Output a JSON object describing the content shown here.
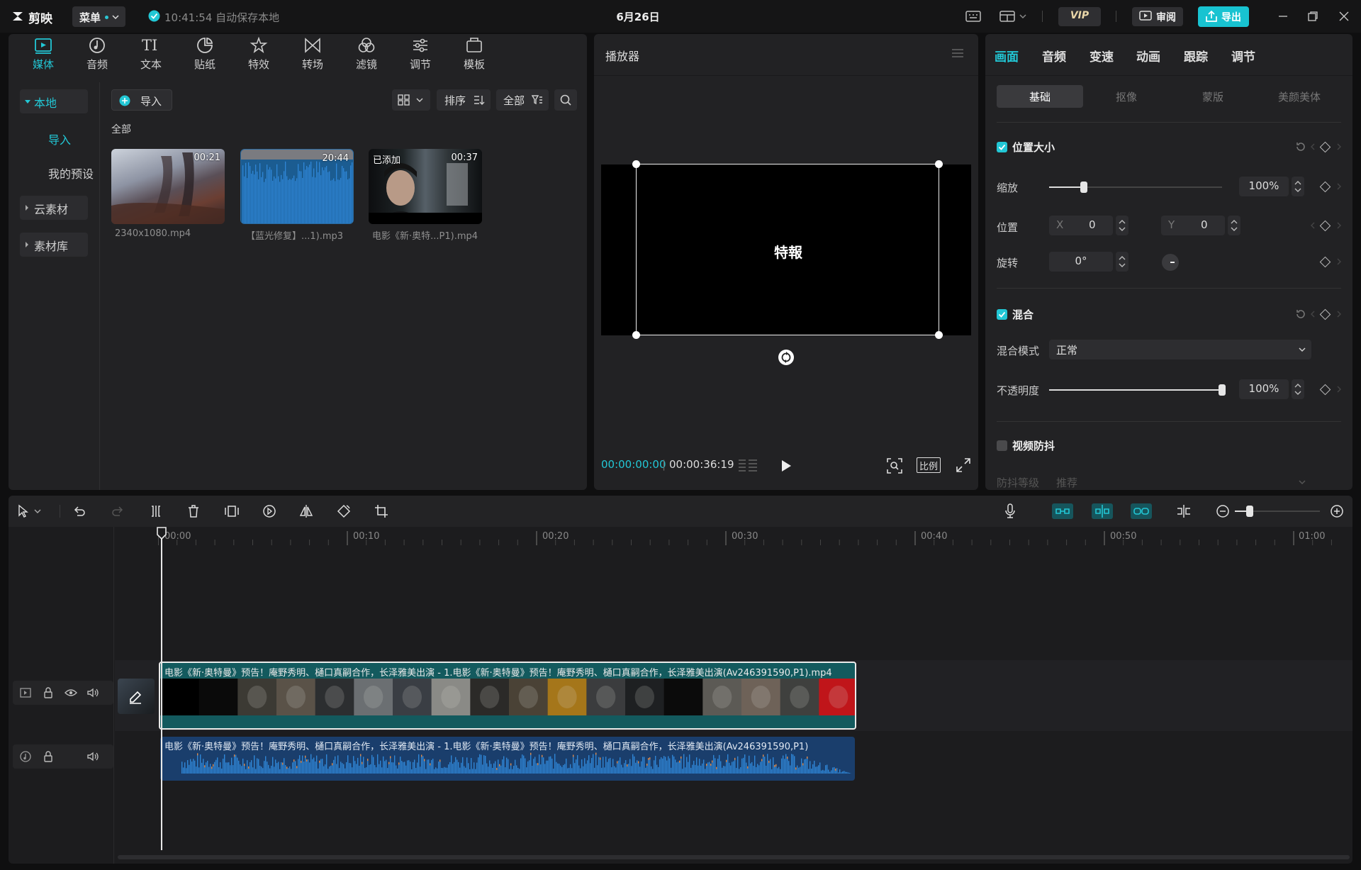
{
  "app": {
    "logo_text": "剪映",
    "menu_label": "菜单",
    "save_status": "10:41:54 自动保存本地",
    "date_title": "6月26日",
    "vip_label": "VIP",
    "review_label": "审阅",
    "export_label": "导出"
  },
  "media_panel": {
    "tabs": [
      {
        "label": "媒体",
        "icon": "media-icon"
      },
      {
        "label": "音频",
        "icon": "audio-icon"
      },
      {
        "label": "文本",
        "icon": "text-icon"
      },
      {
        "label": "贴纸",
        "icon": "sticker-icon"
      },
      {
        "label": "特效",
        "icon": "effects-icon"
      },
      {
        "label": "转场",
        "icon": "transition-icon"
      },
      {
        "label": "滤镜",
        "icon": "filter-icon"
      },
      {
        "label": "调节",
        "icon": "adjust-icon"
      },
      {
        "label": "模板",
        "icon": "template-icon"
      }
    ],
    "sidebar": {
      "local": "本地",
      "import": "导入",
      "presets": "我的预设",
      "cloud": "云素材",
      "library": "素材库"
    },
    "import_button": "导入",
    "sort_label": "排序",
    "filter_label": "全部",
    "section_label": "全部",
    "items": [
      {
        "name": "2340x1080.mp4",
        "duration": "00:21",
        "added": ""
      },
      {
        "name": "【蓝光修复】...1).mp3",
        "duration": "20:44",
        "added": ""
      },
      {
        "name": "电影《新·奥特...P1).mp4",
        "duration": "00:37",
        "added": "已添加"
      }
    ]
  },
  "player": {
    "title": "播放器",
    "overlay_text": "特報",
    "current_time": "00:00:00:00",
    "total_time": "00:00:36:19",
    "ratio_label": "比例"
  },
  "inspector": {
    "tabs": [
      "画面",
      "音频",
      "变速",
      "动画",
      "跟踪",
      "调节"
    ],
    "subtabs": [
      "基础",
      "抠像",
      "蒙版",
      "美颜美体"
    ],
    "position_size": {
      "title": "位置大小",
      "scale_label": "缩放",
      "scale_value": "100%",
      "scale_fraction": 0.2,
      "position_label": "位置",
      "x_label": "X",
      "x_value": "0",
      "y_label": "Y",
      "y_value": "0",
      "rotate_label": "旋转",
      "rotate_value": "0°"
    },
    "blend": {
      "title": "混合",
      "mode_label": "混合模式",
      "mode_value": "正常",
      "opacity_label": "不透明度",
      "opacity_value": "100%",
      "opacity_fraction": 1.0
    },
    "stabilize": {
      "title": "视频防抖",
      "level_label": "防抖等级",
      "level_value": "推荐"
    }
  },
  "timeline": {
    "ruler": [
      "00:00",
      "00:10",
      "00:20",
      "00:30",
      "00:40",
      "00:50",
      "01:00"
    ],
    "video_clip_title": "电影《新·奥特曼》预告！庵野秀明、樋口真嗣合作，长泽雅美出演 - 1.电影《新·奥特曼》预告！庵野秀明、樋口真嗣合作，长泽雅美出演(Av246391590,P1).mp4",
    "audio_clip_title": "电影《新·奥特曼》预告！庵野秀明、樋口真嗣合作，长泽雅美出演 - 1.电影《新·奥特曼》预告！庵野秀明、樋口真嗣合作，长泽雅美出演(Av246391590,P1)"
  }
}
